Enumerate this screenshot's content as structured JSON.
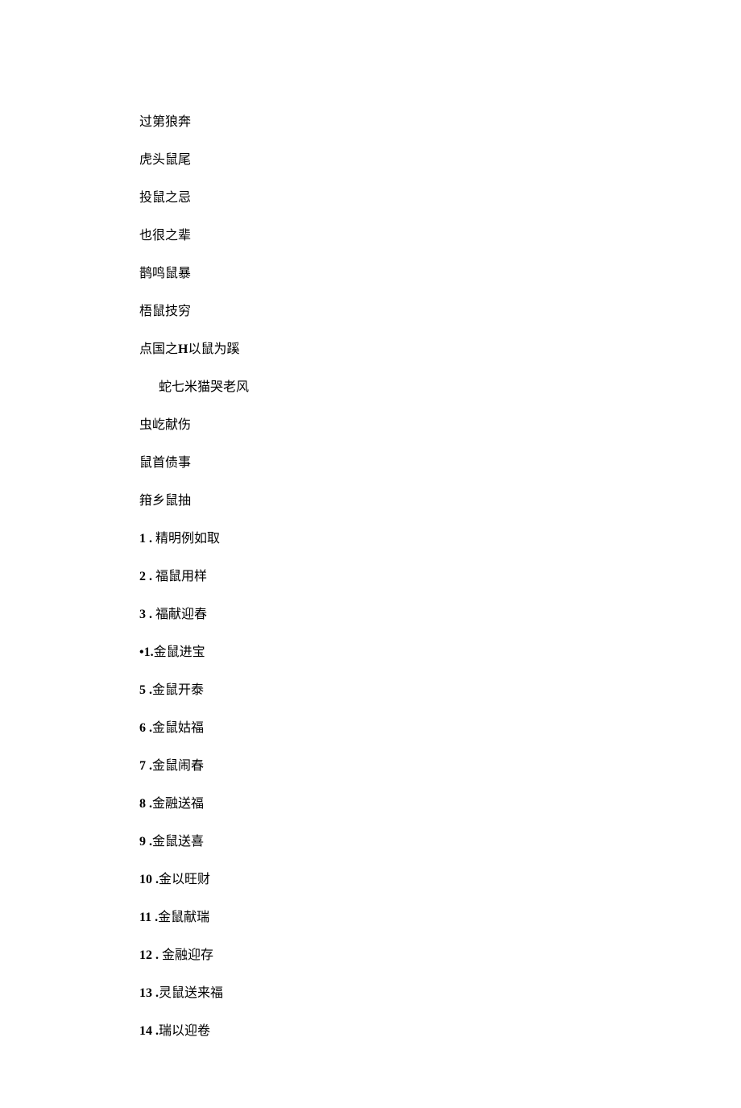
{
  "plain_lines": [
    {
      "text": "过第狼奔",
      "indent": false
    },
    {
      "text": "虎头鼠尾",
      "indent": false
    },
    {
      "text": "投鼠之忌",
      "indent": false
    },
    {
      "text": "也很之辈",
      "indent": false
    },
    {
      "text": "鹊鸣鼠暴",
      "indent": false
    },
    {
      "text": "梧鼠技穷",
      "indent": false
    },
    {
      "text_prefix": "点国之",
      "bold_mid": "H",
      "text_suffix": "以鼠为蹊",
      "indent": false
    },
    {
      "text": "蛇七米猫哭老风",
      "indent": true
    },
    {
      "text": "虫屹献伤",
      "indent": false
    },
    {
      "text": "鼠首债事",
      "indent": false
    },
    {
      "text": "箝乡鼠抽",
      "indent": false
    }
  ],
  "list_items": [
    {
      "num": "1",
      "sep": "   .",
      "gap": " ",
      "text": "精明例如取"
    },
    {
      "num": "2",
      "sep": "   .",
      "gap": " ",
      "text": "福鼠用样"
    },
    {
      "num": "3",
      "sep": "   .",
      "gap": " ",
      "text": "福献迎春"
    },
    {
      "num": "•1.",
      "sep": "",
      "gap": "",
      "text": "金鼠进宝"
    },
    {
      "num": "5",
      "sep": "   .",
      "gap": "",
      "text": "金鼠开泰"
    },
    {
      "num": "6",
      "sep": "   .",
      "gap": "",
      "text": "金鼠姑福"
    },
    {
      "num": "7",
      "sep": "   .",
      "gap": "",
      "text": "金鼠闹春"
    },
    {
      "num": "8",
      "sep": "   .",
      "gap": "",
      "text": "金融送福"
    },
    {
      "num": "9",
      "sep": "   .",
      "gap": "",
      "text": "金鼠送喜"
    },
    {
      "num": "10",
      "sep": "   .",
      "gap": "",
      "text": "金以旺财"
    },
    {
      "num": "11",
      "sep": "   .",
      "gap": "",
      "text": "金鼠献瑞"
    },
    {
      "num": "12",
      "sep": "   .",
      "gap": " ",
      "text": "金融迎存"
    },
    {
      "num": "13",
      "sep": "   .",
      "gap": "",
      "text": "灵鼠送来福"
    },
    {
      "num": "14",
      "sep": "   .",
      "gap": "",
      "text": "瑞以迎卷"
    }
  ]
}
